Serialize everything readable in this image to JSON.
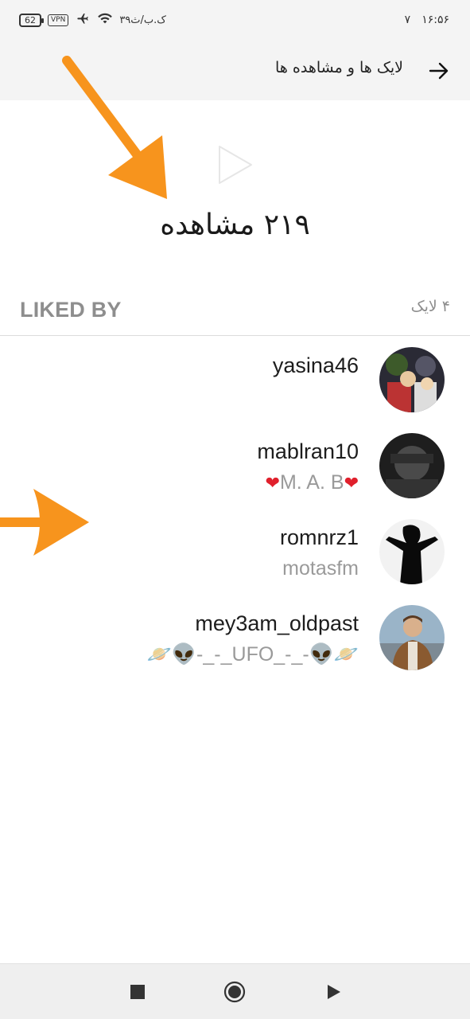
{
  "status_bar": {
    "battery": "62",
    "vpn": "VPN",
    "data_speed": "۳۹ک.ب/ث",
    "time": "۱۶:۵۶",
    "extra": "۷"
  },
  "header": {
    "title": "لایک ها و مشاهده ها",
    "back_icon": "arrow-right-icon"
  },
  "views": {
    "text": "۲۱۹ مشاهده",
    "icon": "play-icon"
  },
  "likes": {
    "section_label": "LIKED BY",
    "count_text": "۴ لایک"
  },
  "users": [
    {
      "username": "yasina46",
      "subtitle": ""
    },
    {
      "username": "mablran10",
      "subtitle_pre": "❤",
      "subtitle": "M. A. B",
      "subtitle_post": "❤"
    },
    {
      "username": "romnrz1",
      "subtitle": "motasfm"
    },
    {
      "username": "mey3am_oldpast",
      "subtitle": "🪐👽-_-_UFO_-_-👽🪐"
    }
  ],
  "colors": {
    "annotation_arrow": "#f7941d",
    "heart": "#e0202c",
    "secondary_text": "#8e8e8e"
  }
}
